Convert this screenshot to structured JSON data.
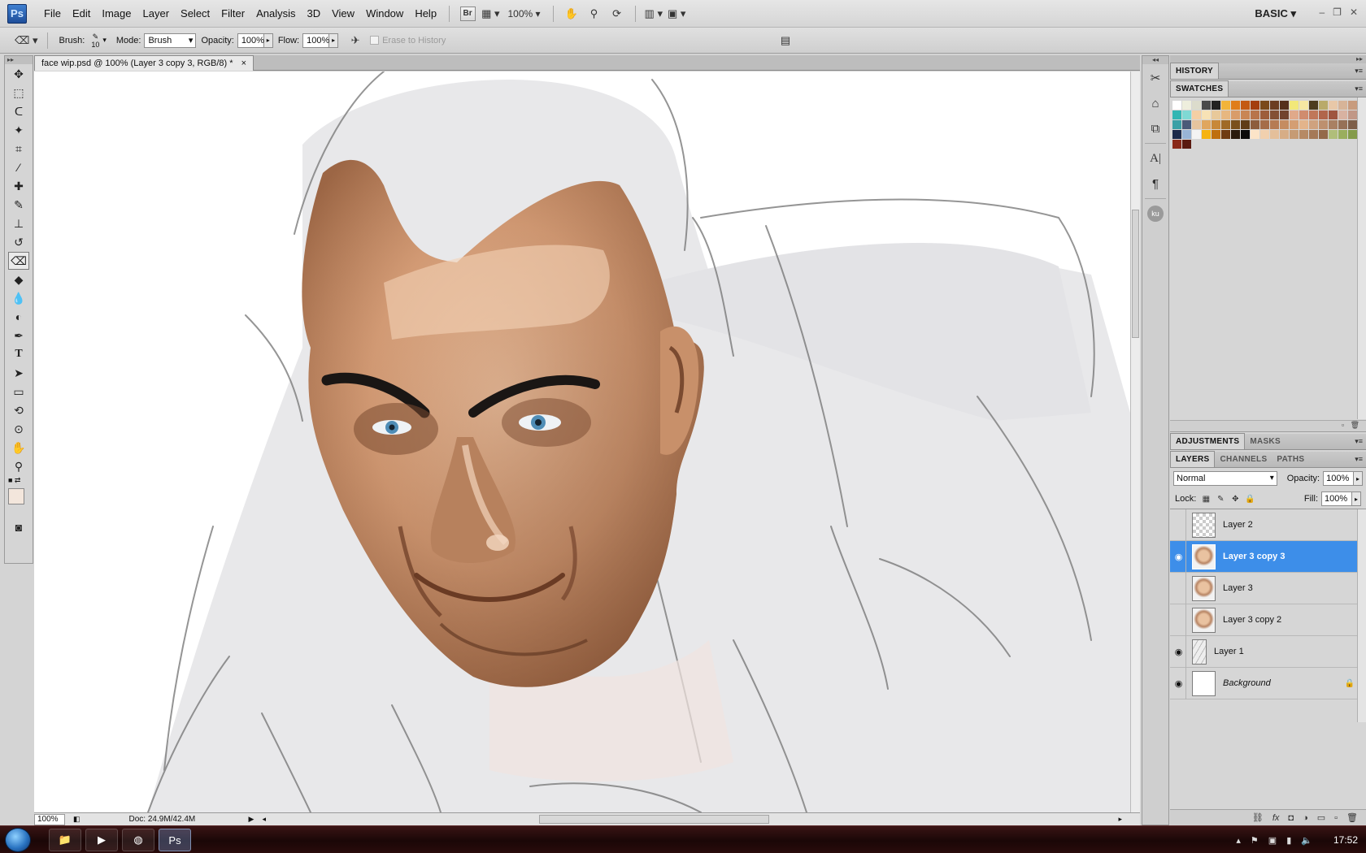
{
  "app": {
    "logo": "Ps",
    "workspace": "BASIC ▾"
  },
  "menu": [
    "File",
    "Edit",
    "Image",
    "Layer",
    "Select",
    "Filter",
    "Analysis",
    "3D",
    "View",
    "Window",
    "Help"
  ],
  "appbar": {
    "bridge_label": "Br",
    "zoom": "100%"
  },
  "options": {
    "brush_label": "Brush:",
    "brush_size": "10",
    "mode_label": "Mode:",
    "mode_value": "Brush",
    "opacity_label": "Opacity:",
    "opacity_value": "100%",
    "flow_label": "Flow:",
    "flow_value": "100%",
    "erase_history": "Erase to History"
  },
  "document": {
    "tab_title": "face wip.psd @ 100% (Layer 3 copy 3, RGB/8) *",
    "close_glyph": "×",
    "status_zoom": "100%",
    "status_doc": "Doc: 24.9M/42.4M"
  },
  "panels": {
    "history_tab": "HISTORY",
    "swatches_tab": "SWATCHES",
    "adjustments_tab": "ADJUSTMENTS",
    "masks_tab": "MASKS",
    "layers_tab": "LAYERS",
    "channels_tab": "CHANNELS",
    "paths_tab": "PATHS"
  },
  "swatches": [
    "#ffffff",
    "#eeeedd",
    "#dcdccc",
    "#4a4a4a",
    "#222222",
    "#f2b43a",
    "#e07d1a",
    "#c45a13",
    "#a43d0e",
    "#7a4a1a",
    "#6b3d22",
    "#55301c",
    "#f2e879",
    "#f6e8a2",
    "#4d3c1e",
    "#b9aa6a",
    "#e8c8a8",
    "#d7b498",
    "#c89b7d",
    "#32b6b3",
    "#7fd9d4",
    "#f4cfa4",
    "#f7e2b5",
    "#e8c99a",
    "#e7b780",
    "#d99c6a",
    "#c98654",
    "#b8744a",
    "#9d5d3b",
    "#835034",
    "#71432d",
    "#e0a98a",
    "#d08c6e",
    "#c0775a",
    "#b1654b",
    "#9f553f",
    "#d8b2a1",
    "#c19786",
    "#3aa0a6",
    "#4a5a78",
    "#e6c49e",
    "#e0a65e",
    "#c88838",
    "#a06a26",
    "#7a501c",
    "#603d16",
    "#8d5d3e",
    "#a56c49",
    "#b67b53",
    "#c58c61",
    "#d49e73",
    "#e3b48b",
    "#cfa27f",
    "#bd906f",
    "#a98063",
    "#967157",
    "#7e5f49",
    "#1c2a4a",
    "#98b4d6",
    "#f3f3f3",
    "#f6b312",
    "#bf6f0e",
    "#6f3b12",
    "#2a1a0c",
    "#0b0b0b",
    "#fce4c8",
    "#f1d0ae",
    "#e4bf9a",
    "#d7ad86",
    "#c69b74",
    "#b68a65",
    "#a57957",
    "#946a4a",
    "#b0be7a",
    "#9aae5e",
    "#849b4a",
    "#8a2a1a",
    "#5a1a10"
  ],
  "layers_panel": {
    "blend_mode": "Normal",
    "opacity_label": "Opacity:",
    "opacity_value": "100%",
    "lock_label": "Lock:",
    "fill_label": "Fill:",
    "fill_value": "100%"
  },
  "layers": [
    {
      "name": "Layer 2",
      "visible": false,
      "thumb": "checker",
      "selected": false
    },
    {
      "name": "Layer 3 copy 3",
      "visible": true,
      "thumb": "face",
      "selected": true
    },
    {
      "name": "Layer 3",
      "visible": false,
      "thumb": "face",
      "selected": false
    },
    {
      "name": "Layer 3 copy 2",
      "visible": false,
      "thumb": "face",
      "selected": false
    },
    {
      "name": "Layer 1",
      "visible": true,
      "thumb": "sketch",
      "selected": false
    },
    {
      "name": "Background",
      "visible": true,
      "thumb": "white",
      "selected": false,
      "locked": true
    }
  ],
  "taskbar": {
    "time": "17:52"
  },
  "colors": {
    "selection": "#3d8ee9",
    "foreground": "#f3e6dc",
    "background": "#ffffff"
  }
}
